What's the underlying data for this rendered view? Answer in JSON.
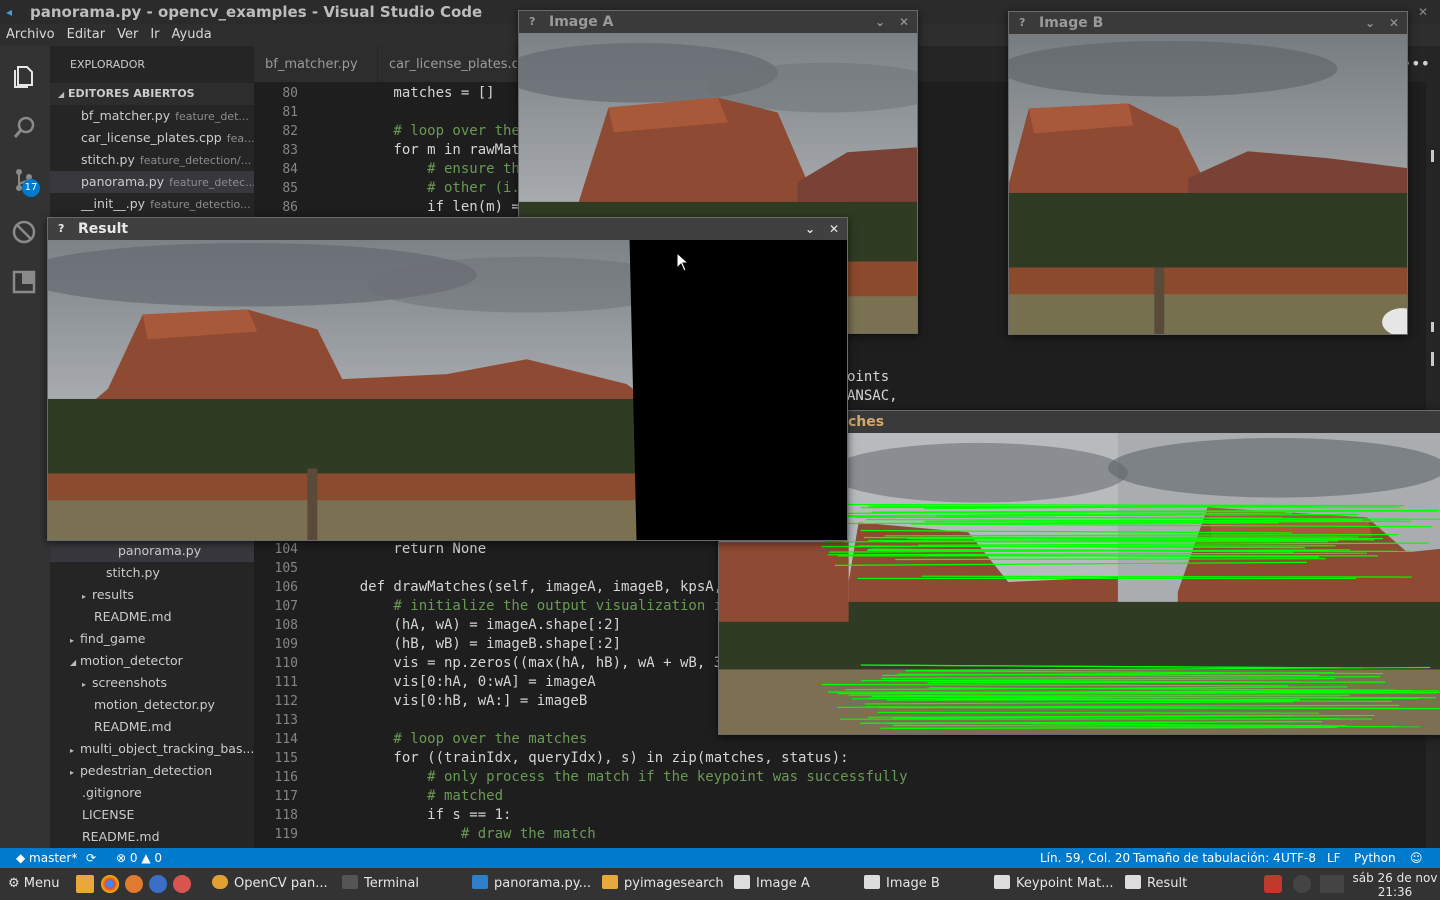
{
  "title_bar": {
    "title": "panorama.py - opencv_examples - Visual Studio Code"
  },
  "menu": [
    "Archivo",
    "Editar",
    "Ver",
    "Ir",
    "Ayuda"
  ],
  "activity": {
    "items": [
      "files-icon",
      "search-icon",
      "source-control-icon",
      "debug-icon",
      "extensions-icon"
    ],
    "scm_badge": "17"
  },
  "sidebar": {
    "header": "EXPLORADOR",
    "open_editors_label": "EDITORES ABIERTOS",
    "open_editors": [
      {
        "name": "bf_matcher.py",
        "path": "feature_det..."
      },
      {
        "name": "car_license_plates.cpp",
        "path": "fea..."
      },
      {
        "name": "stitch.py",
        "path": "feature_detection/..."
      },
      {
        "name": "panorama.py",
        "path": "feature_detec..."
      },
      {
        "name": "__init__.py",
        "path": "feature_detectio..."
      }
    ],
    "tree": [
      {
        "label": "panorama.py",
        "type": "file"
      },
      {
        "label": "stitch.py",
        "type": "file"
      },
      {
        "label": "results",
        "type": "folder-collapsed"
      },
      {
        "label": "README.md",
        "type": "file"
      },
      {
        "label": "find_game",
        "type": "folder-collapsed"
      },
      {
        "label": "motion_detector",
        "type": "folder-expanded"
      },
      {
        "label": "screenshots",
        "type": "folder-collapsed"
      },
      {
        "label": "motion_detector.py",
        "type": "file"
      },
      {
        "label": "README.md",
        "type": "file"
      },
      {
        "label": "multi_object_tracking_bas...",
        "type": "folder-collapsed"
      },
      {
        "label": "pedestrian_detection",
        "type": "folder-collapsed"
      },
      {
        "label": ".gitignore",
        "type": "file"
      },
      {
        "label": "LICENSE",
        "type": "file"
      },
      {
        "label": "README.md",
        "type": "file"
      }
    ]
  },
  "tabs": [
    "bf_matcher.py",
    "car_license_plates.cpp"
  ],
  "editor": {
    "top_lines": [
      {
        "n": "80",
        "code": "        matches = []"
      },
      {
        "n": "81",
        "code": ""
      },
      {
        "n": "82",
        "code": "        # loop over the"
      },
      {
        "n": "83",
        "code": "        for m in rawMat"
      },
      {
        "n": "84",
        "code": "            # ensure th"
      },
      {
        "n": "85",
        "code": "            # other (i."
      },
      {
        "n": "86",
        "code": "            if len(m) ="
      }
    ],
    "mid_fragments": [
      "oints",
      "ANSAC,",
      "ches"
    ],
    "bottom_lines": [
      {
        "n": "104",
        "code": "        return None"
      },
      {
        "n": "105",
        "code": ""
      },
      {
        "n": "106",
        "code": "    def drawMatches(self, imageA, imageB, kpsA,"
      },
      {
        "n": "107",
        "code": "        # initialize the output visualization i"
      },
      {
        "n": "108",
        "code": "        (hA, wA) = imageA.shape[:2]"
      },
      {
        "n": "109",
        "code": "        (hB, wB) = imageB.shape[:2]"
      },
      {
        "n": "110",
        "code": "        vis = np.zeros((max(hA, hB), wA + wB, 3"
      },
      {
        "n": "111",
        "code": "        vis[0:hA, 0:wA] = imageA"
      },
      {
        "n": "112",
        "code": "        vis[0:hB, wA:] = imageB"
      },
      {
        "n": "113",
        "code": ""
      },
      {
        "n": "114",
        "code": "        # loop over the matches"
      },
      {
        "n": "115",
        "code": "        for ((trainIdx, queryIdx), s) in zip(matches, status):"
      },
      {
        "n": "116",
        "code": "            # only process the match if the keypoint was successfully"
      },
      {
        "n": "117",
        "code": "            # matched"
      },
      {
        "n": "118",
        "code": "            if s == 1:"
      },
      {
        "n": "119",
        "code": "                # draw the match"
      }
    ]
  },
  "windows": {
    "image_a": {
      "title": "Image A"
    },
    "image_b": {
      "title": "Image B"
    },
    "result": {
      "title": "Result"
    },
    "matches": {
      "title": "Keypoint Matches"
    }
  },
  "status_bar": {
    "branch": "master*",
    "errors": "0",
    "warnings": "0",
    "position": "Lín. 59, Col. 20",
    "tab_size": "Tamaño de tabulación: 4",
    "encoding": "UTF-8",
    "eol": "LF",
    "language": "Python"
  },
  "taskbar": {
    "menu_label": "Menu",
    "tasks": [
      "OpenCV pan...",
      "Terminal",
      "panorama.py...",
      "pyimagesearch",
      "Image A",
      "Image B",
      "Keypoint Mat...",
      "Result"
    ],
    "date": "sáb 26 de nov",
    "time": "21:36"
  },
  "colors": {
    "accent": "#007acc",
    "match_lines": "#00ff00"
  }
}
